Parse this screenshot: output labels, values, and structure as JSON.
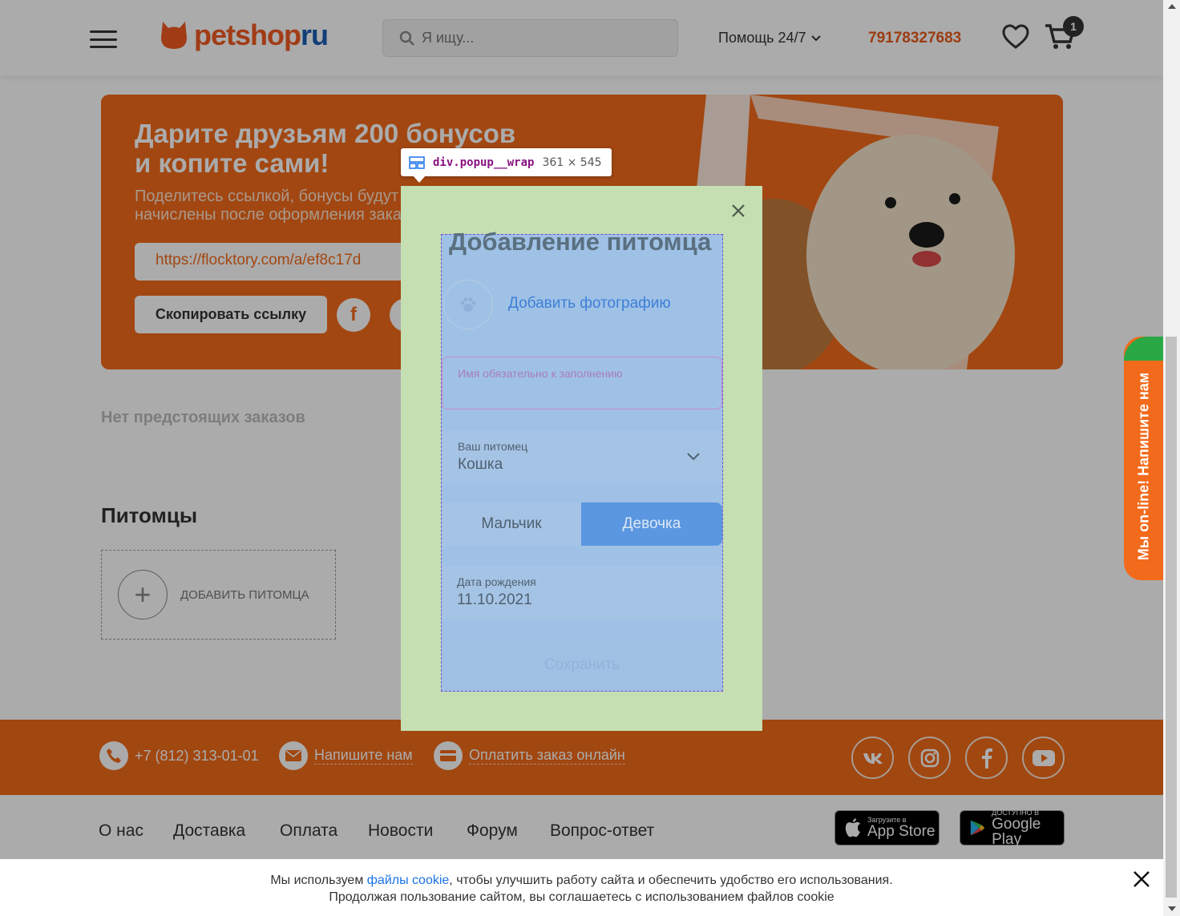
{
  "header": {
    "logo_main": "petshop",
    "logo_ru": "ru",
    "search_placeholder": "Я ищу...",
    "help_label": "Помощь 24/7",
    "phone": "79178327683",
    "cart_count": "1"
  },
  "banner": {
    "title_line1": "Дарите друзьям ",
    "title_bold": "200 бонусов",
    "title_line2": "и копите сами!",
    "subtitle": "Поделитесь ссылкой, бонусы будут начислены после оформления заказа!",
    "link": "https://flocktory.com/a/ef8c17d",
    "copy_button": "Скопировать ссылку"
  },
  "orders": {
    "empty_text": "Нет предстоящих заказов"
  },
  "pets": {
    "title": "Питомцы",
    "add_label": "ДОБАВИТЬ ПИТОМЦА"
  },
  "popup": {
    "title": "Добавление питомца",
    "add_photo": "Добавить фотографию",
    "name_placeholder": "Имя обязательно к заполнению",
    "pet_label": "Ваш питомец",
    "pet_value": "Кошка",
    "gender_male": "Мальчик",
    "gender_female": "Девочка",
    "birth_label": "Дата рождения",
    "birth_value": "11.10.2021",
    "save": "Сохранить"
  },
  "devtools": {
    "selector": "div.popup__wrap",
    "size": "361 × 545"
  },
  "footer": {
    "phone": "+7 (812) 313-01-01",
    "write_us": "Напишите нам",
    "pay_online": "Оплатить заказ онлайн",
    "nav": [
      "О нас",
      "Доставка",
      "Оплата",
      "Новости",
      "Форум",
      "Вопрос-ответ"
    ],
    "appstore_small": "Загрузите в",
    "appstore_big": "App Store",
    "googleplay_small": "ДОСТУПНО В",
    "googleplay_big": "Google Play"
  },
  "online_chat": "Мы on-line! Напишите нам",
  "cookie": {
    "text_before": "Мы используем ",
    "link": "файлы cookie",
    "text_after": ", чтобы улучшить работу сайта и обеспечить удобство его использования.",
    "line2": "Продолжая пользование сайтом, вы соглашаетесь с использованием файлов cookie"
  },
  "colors": {
    "brand_orange": "#f26a1b",
    "brand_blue": "#1a5fb4",
    "link_blue": "#3d7fd6"
  }
}
